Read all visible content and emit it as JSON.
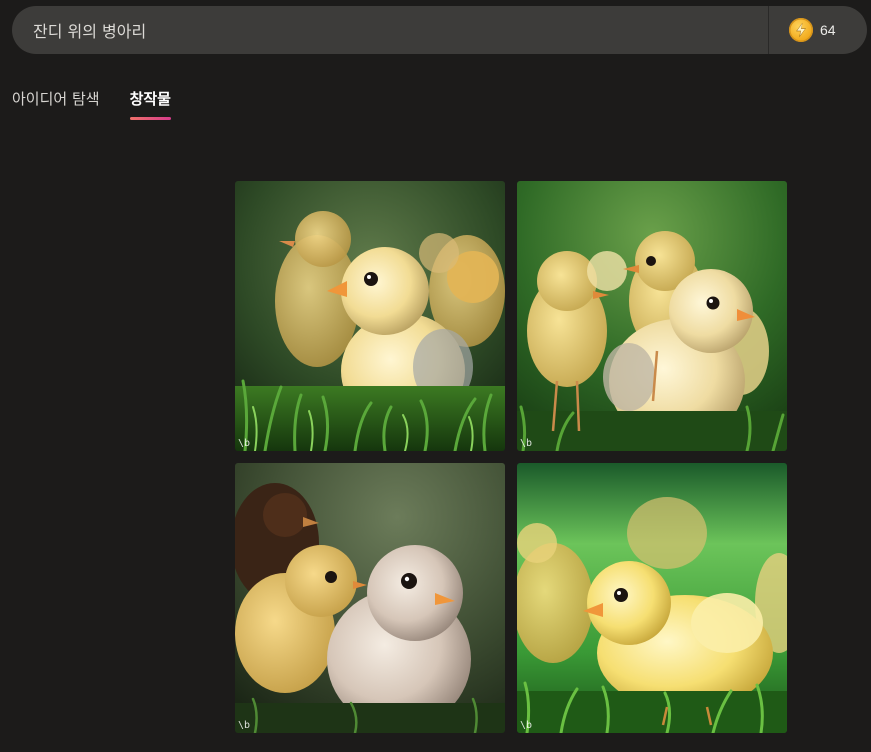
{
  "prompt": {
    "value": "잔디 위의 병아리"
  },
  "boosts": {
    "count": "64",
    "icon": "lightning-coin-icon",
    "coin_color": "#f0a81a"
  },
  "tabs": [
    {
      "label": "아이디어 탐색",
      "active": false
    },
    {
      "label": "창작물",
      "active": true
    }
  ],
  "accent_gradient": [
    "#f0716a",
    "#d63c8c"
  ],
  "images": [
    {
      "subject": "yellow chicks on grass",
      "watermark": "\\b"
    },
    {
      "subject": "yellow chicks on grass",
      "watermark": "\\b"
    },
    {
      "subject": "chicks with dark hen behind",
      "watermark": "\\b"
    },
    {
      "subject": "yellow chick on bright green grass",
      "watermark": "\\b"
    }
  ]
}
